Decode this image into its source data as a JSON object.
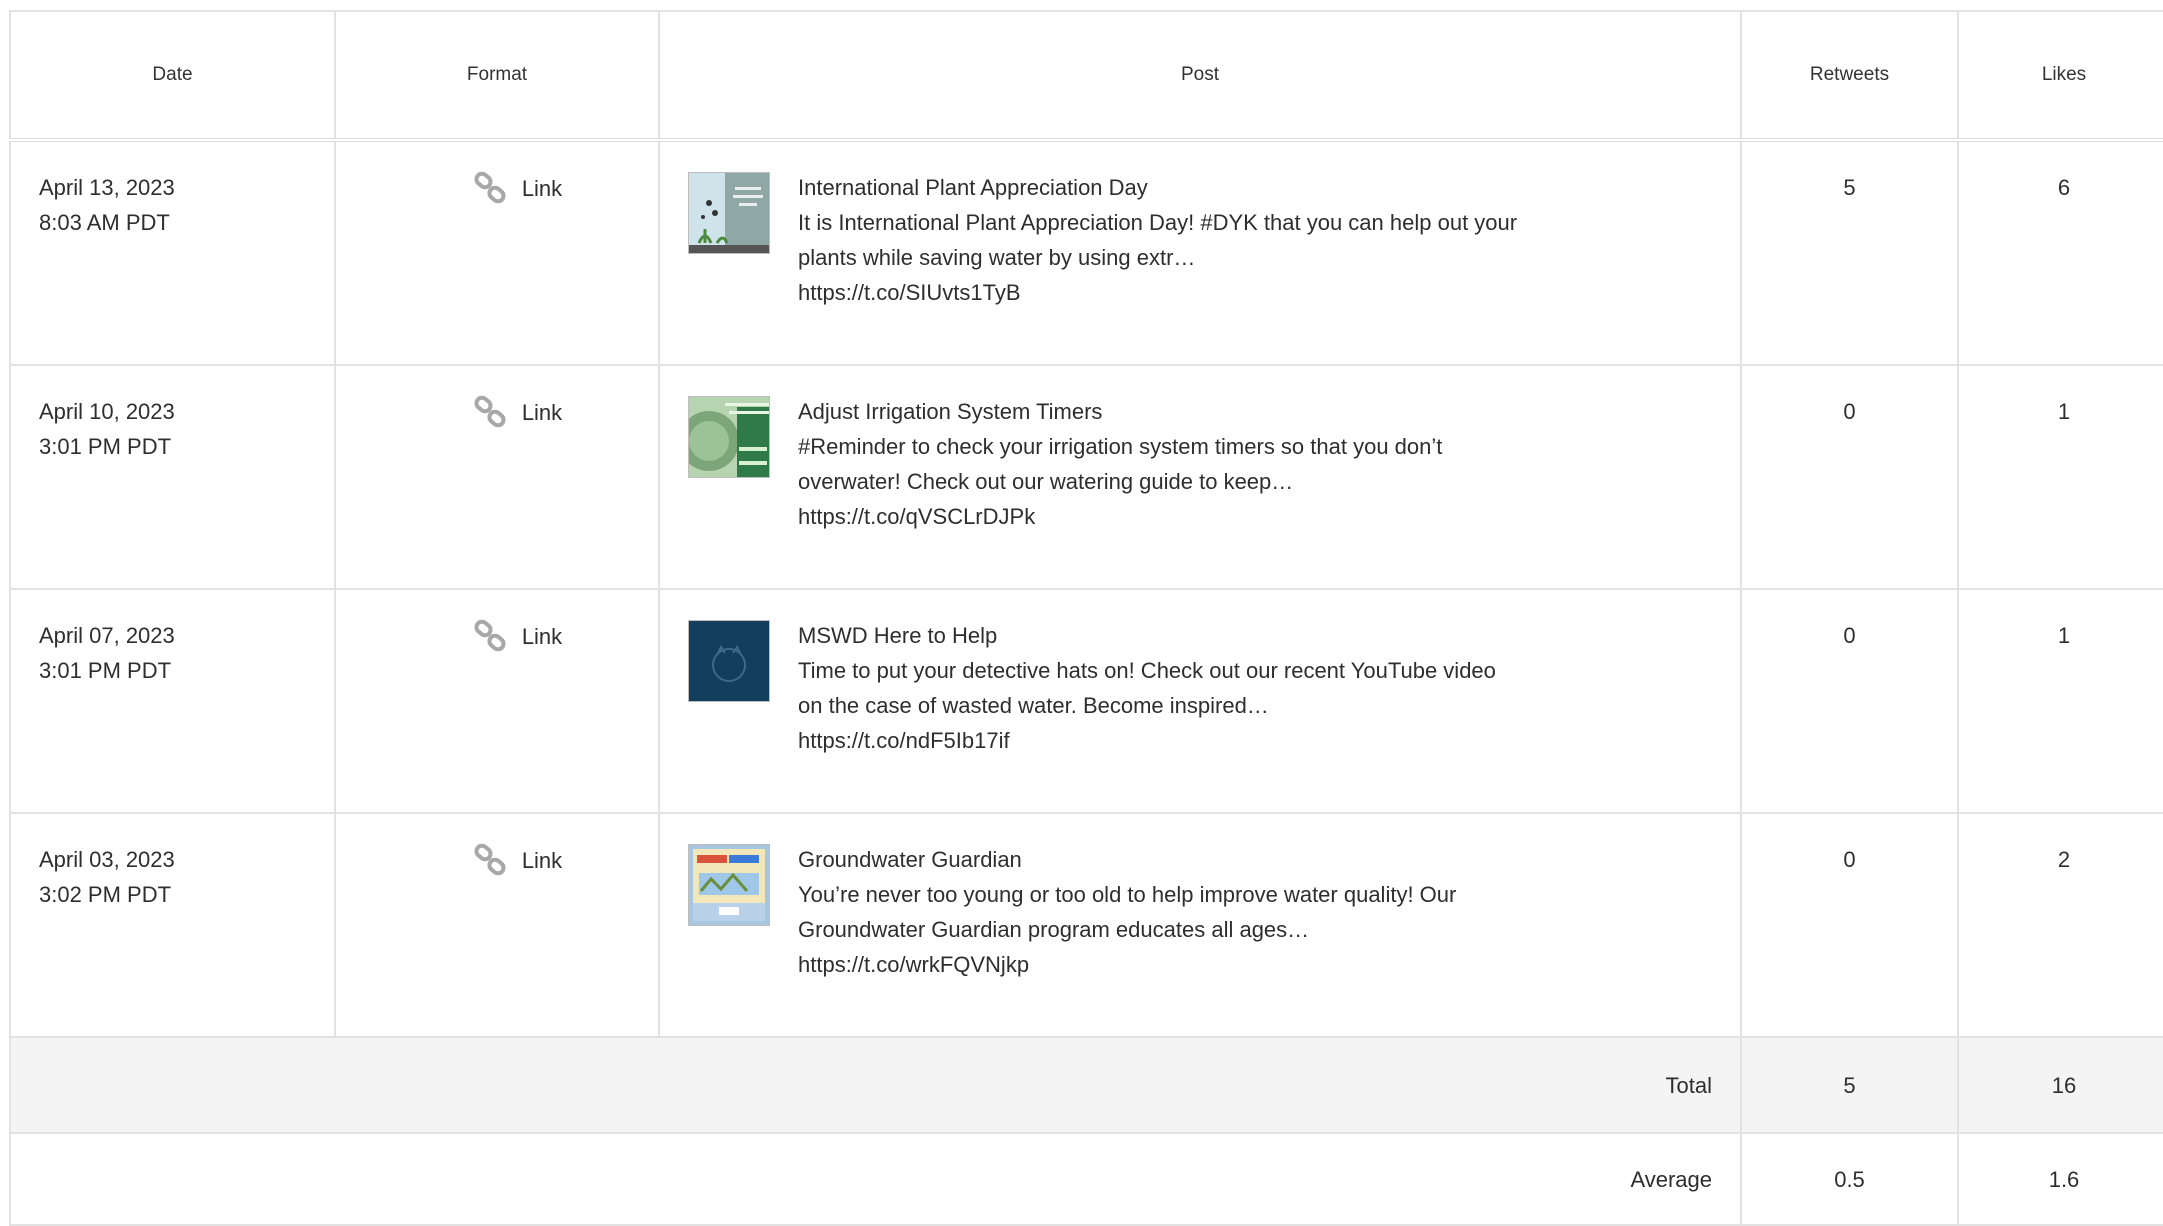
{
  "table": {
    "headers": {
      "date": "Date",
      "format": "Format",
      "post": "Post",
      "retweets": "Retweets",
      "likes": "Likes"
    },
    "rows": [
      {
        "date": "April 13, 2023",
        "time": "8:03 AM PDT",
        "format": "Link",
        "title": "International Plant Appreciation Day",
        "body": "It is International Plant Appreciation Day! #DYK that you can help out your plants while saving water by using extr…",
        "url": "https://t.co/SIUvts1TyB",
        "retweets": "5",
        "likes": "6"
      },
      {
        "date": "April 10, 2023",
        "time": "3:01 PM PDT",
        "format": "Link",
        "title": "Adjust Irrigation System Timers",
        "body": "#Reminder to check your irrigation system timers so that you don’t overwater! Check out our watering guide to keep…",
        "url": "https://t.co/qVSCLrDJPk",
        "retweets": "0",
        "likes": "1"
      },
      {
        "date": "April 07, 2023",
        "time": "3:01 PM PDT",
        "format": "Link",
        "title": "MSWD Here to Help",
        "body": "Time to put your detective hats on! Check out our recent YouTube video on the case of wasted water. Become inspired…",
        "url": "https://t.co/ndF5Ib17if",
        "retweets": "0",
        "likes": "1"
      },
      {
        "date": "April 03, 2023",
        "time": "3:02 PM PDT",
        "format": "Link",
        "title": "Groundwater Guardian",
        "body": "You’re never too young or too old to help improve water quality! Our Groundwater Guardian program educates all ages…",
        "url": "https://t.co/wrkFQVNjkp",
        "retweets": "0",
        "likes": "2"
      }
    ],
    "total": {
      "label": "Total",
      "retweets": "5",
      "likes": "16"
    },
    "average": {
      "label": "Average",
      "retweets": "0.5",
      "likes": "1.6"
    }
  },
  "icons": {
    "format": "link-icon"
  },
  "colors": {
    "border": "#e2e2e2",
    "total_bg": "#f4f4f4",
    "text": "#2e2e2e"
  }
}
